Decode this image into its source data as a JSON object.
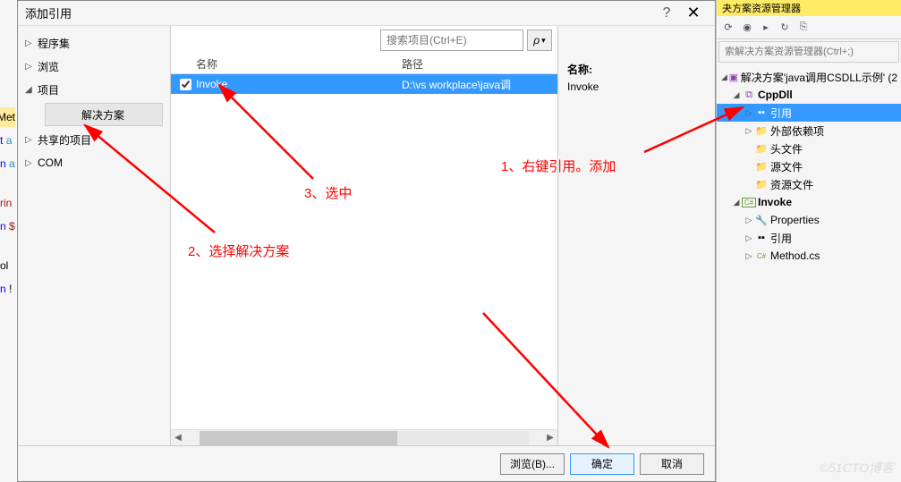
{
  "editor": {
    "t1a": "t",
    "t1b": "a",
    "t2a": "n",
    "t2b": "a",
    "t3": "rin",
    "t4a": "n",
    "t4b": "$",
    "t5": "ol",
    "t6a": "n",
    "t6b": "!",
    "met": "Met"
  },
  "dialog": {
    "title": "添加引用",
    "help": "?",
    "close": "✕",
    "nav": {
      "assemblies": "程序集",
      "browse": "浏览",
      "projects": "项目",
      "solution": "解决方案",
      "shared": "共享的项目",
      "com": "COM"
    },
    "search": {
      "placeholder": "搜索项目(Ctrl+E)",
      "icon": "🔍"
    },
    "cols": {
      "name": "名称",
      "path": "路径"
    },
    "row": {
      "name": "Invoke",
      "path": "D:\\vs workplace\\java调"
    },
    "rp": {
      "label": "名称:",
      "value": "Invoke"
    },
    "footer": {
      "browse": "浏览(B)...",
      "ok": "确定",
      "cancel": "取消"
    }
  },
  "solExplorer": {
    "title": "夬方案资源管理器",
    "searchPlaceholder": "索解决方案资源管理器(Ctrl+;)",
    "solution": "解决方案'java调用CSDLL示例' (2",
    "proj1": "CppDll",
    "ref": "引用",
    "extdep": "外部依赖项",
    "headers": "头文件",
    "sources": "源文件",
    "resources": "资源文件",
    "proj2": "Invoke",
    "props": "Properties",
    "ref2": "引用",
    "method": "Method.cs"
  },
  "annotations": {
    "a1": "1、右键引用。添加",
    "a2": "2、选择解决方案",
    "a3": "3、选中"
  },
  "watermark": "©51CTO博客"
}
